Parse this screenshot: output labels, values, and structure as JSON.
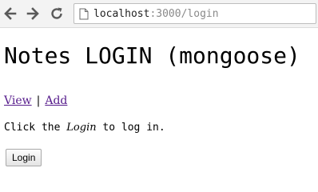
{
  "browser": {
    "url_host": "localhost",
    "url_path": ":3000/login",
    "icons": {
      "back": "back-arrow-icon",
      "forward": "forward-arrow-icon",
      "reload": "reload-icon",
      "page": "page-icon"
    }
  },
  "page": {
    "title": "Notes LOGIN (mongoose)",
    "nav": {
      "view_label": "View",
      "separator": "|",
      "add_label": "Add"
    },
    "message": {
      "before": "Click the ",
      "emphasis": "Login",
      "after": " to log in."
    },
    "login_button_label": "Login"
  }
}
